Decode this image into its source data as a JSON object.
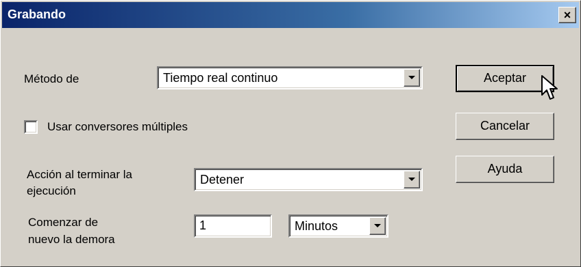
{
  "window": {
    "title": "Grabando",
    "close_glyph": "×"
  },
  "fields": {
    "method_label": "Método de",
    "method_value": "Tiempo real continuo",
    "multi_conv_label": "Usar conversores múltiples",
    "multi_conv_checked": false,
    "end_action_label_1": "Acción al terminar la",
    "end_action_label_2": "ejecución",
    "end_action_value": "Detener",
    "restart_label_1": "Comenzar de",
    "restart_label_2": "nuevo la demora",
    "restart_delay_value": "1",
    "restart_unit_value": "Minutos"
  },
  "buttons": {
    "ok": "Aceptar",
    "cancel": "Cancelar",
    "help": "Ayuda"
  },
  "colors": {
    "face": "#d4d0c8",
    "title_start": "#0a246a",
    "title_end": "#a6caf0"
  },
  "icons": {
    "close": "close-icon",
    "dropdown": "chevron-down-icon",
    "cursor": "arrow-cursor-icon"
  }
}
